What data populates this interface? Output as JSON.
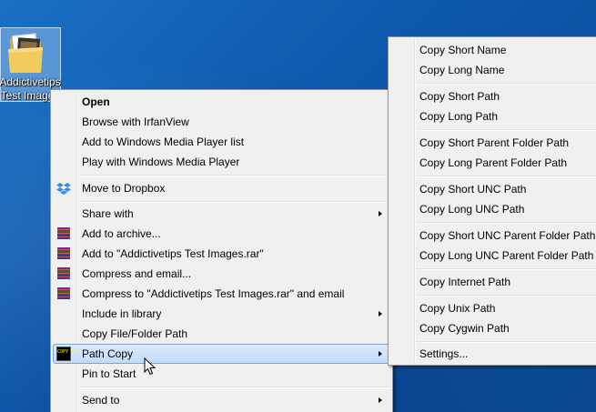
{
  "desktop": {
    "icon_label_line1": "Addictivetips",
    "icon_label_line2": "Test Images"
  },
  "context_menu": {
    "items": [
      {
        "label": "Open",
        "bold": true
      },
      {
        "label": "Browse with IrfanView"
      },
      {
        "label": "Add to Windows Media Player list"
      },
      {
        "label": "Play with Windows Media Player"
      },
      {
        "label": "Move to Dropbox",
        "icon": "dropbox-icon"
      },
      {
        "label": "Share with",
        "submenu": true
      },
      {
        "label": "Add to archive...",
        "icon": "winrar-icon"
      },
      {
        "label": "Add to \"Addictivetips Test Images.rar\"",
        "icon": "winrar-icon"
      },
      {
        "label": "Compress and email...",
        "icon": "winrar-icon"
      },
      {
        "label": "Compress to \"Addictivetips Test Images.rar\" and email",
        "icon": "winrar-icon"
      },
      {
        "label": "Include in library",
        "submenu": true
      },
      {
        "label": "Copy File/Folder Path"
      },
      {
        "label": "Path Copy",
        "submenu": true,
        "icon": "path-copy-icon",
        "highlighted": true
      },
      {
        "label": "Pin to Start"
      },
      {
        "label": "Send to",
        "submenu": true
      }
    ]
  },
  "path_copy_submenu": {
    "items": [
      "Copy Short Name",
      "Copy Long Name",
      "Copy Short Path",
      "Copy Long Path",
      "Copy Short Parent Folder Path",
      "Copy Long Parent Folder Path",
      "Copy Short UNC Path",
      "Copy Long UNC Path",
      "Copy Short UNC Parent Folder Path",
      "Copy Long UNC Parent Folder Path",
      "Copy Internet Path",
      "Copy Unix Path",
      "Copy Cygwin Path",
      "Settings..."
    ]
  },
  "icons": {
    "path_copy_icon_text": "COPY C:\\"
  },
  "colors": {
    "desktop": "#0f5aaf",
    "menu_bg": "#f0f0f0",
    "highlight_border": "#7da2ce"
  }
}
